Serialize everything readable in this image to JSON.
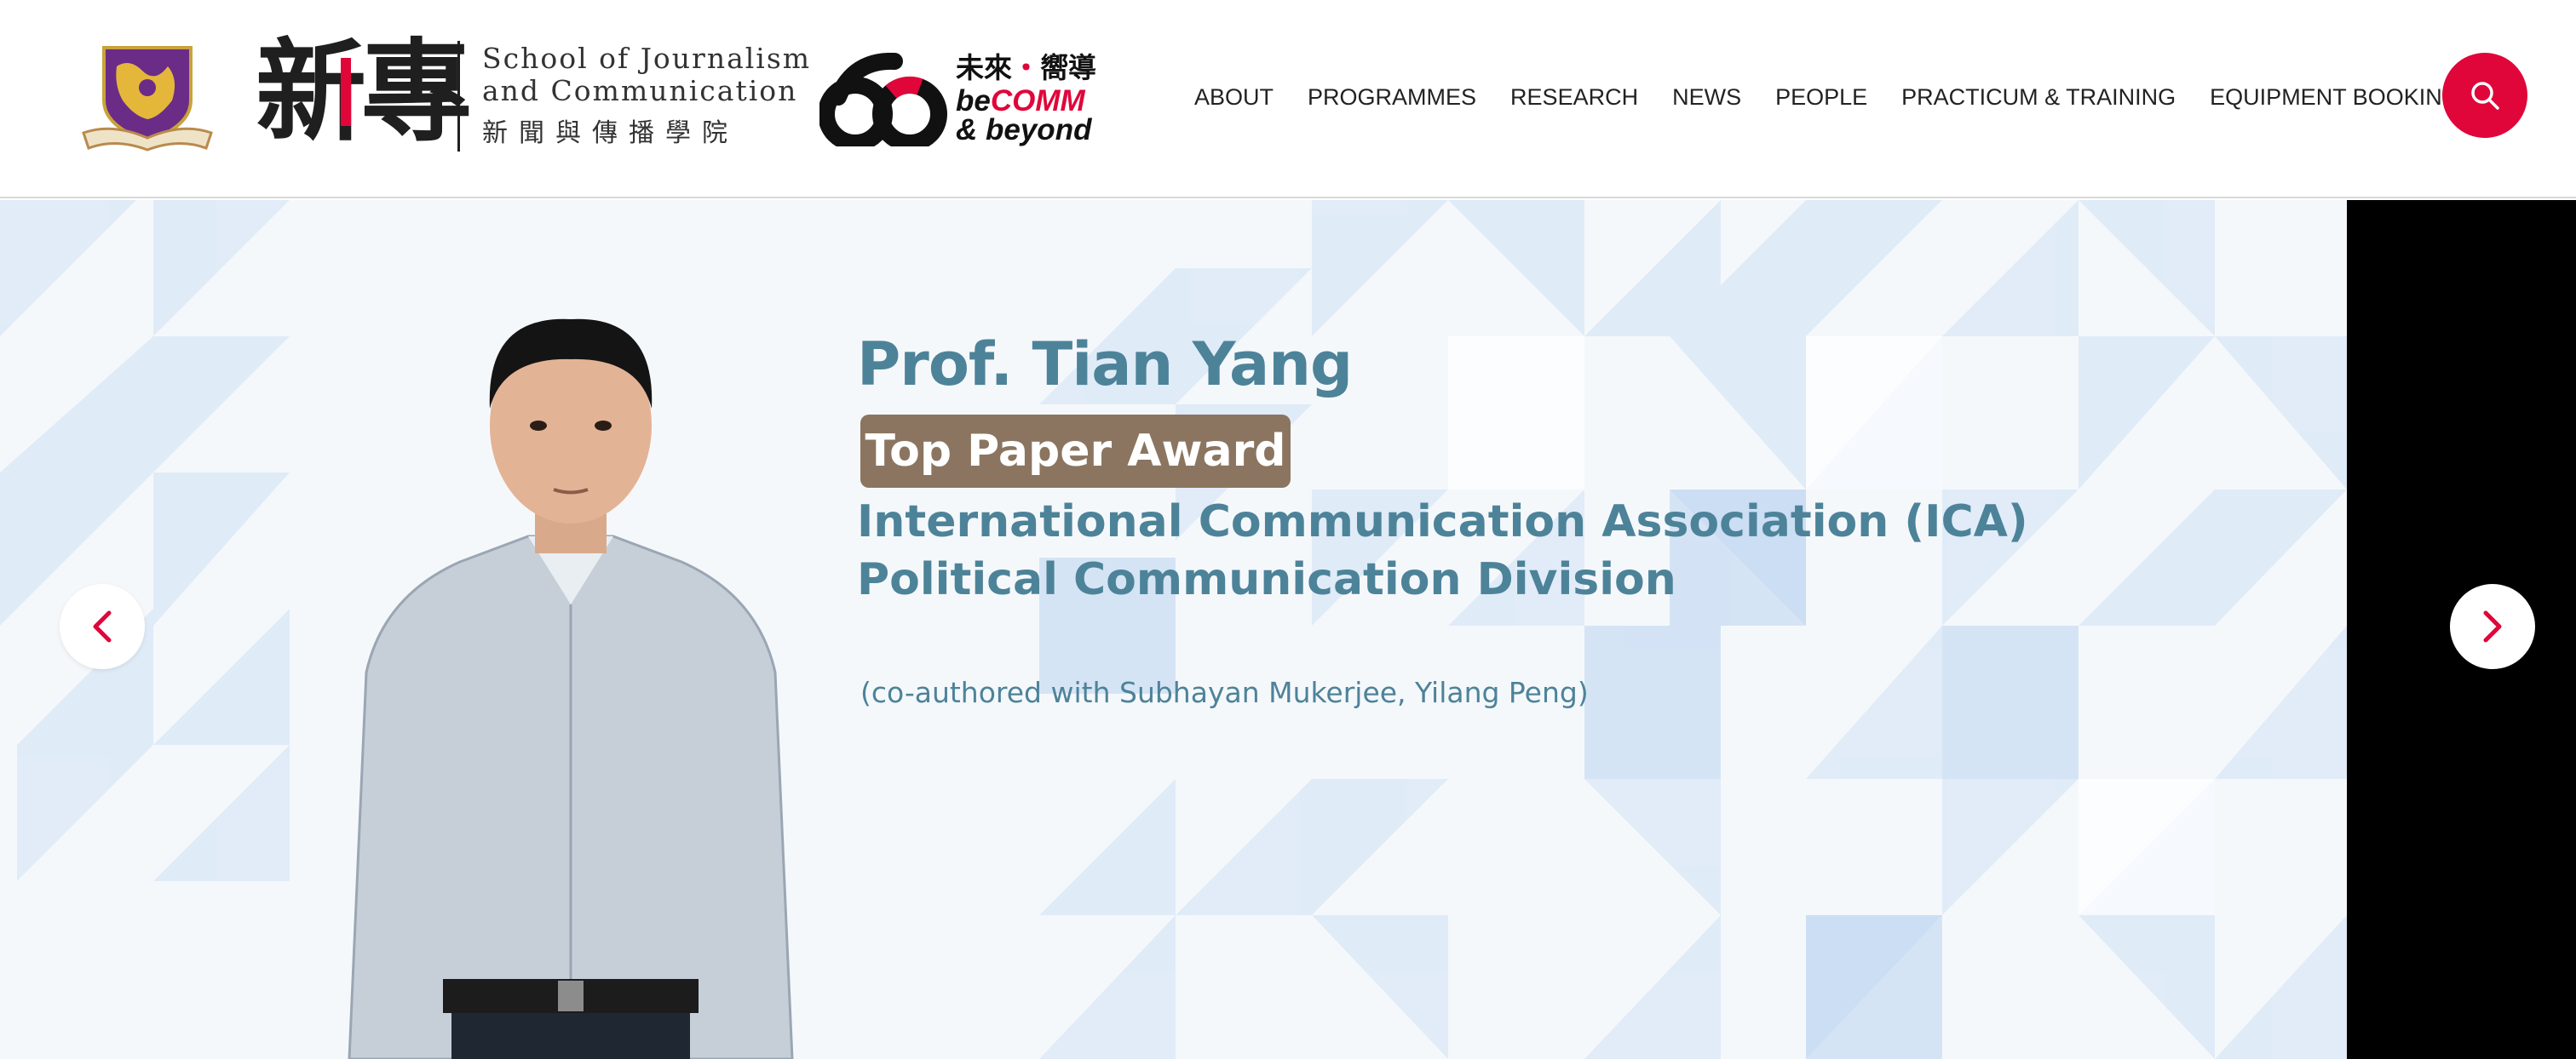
{
  "header": {
    "logo_chars_black_1": "新",
    "logo_chars_red": "",
    "logo_chars_black_2": "專",
    "school_en_line1": "School of Journalism",
    "school_en_line2": "and Communication",
    "school_zh": "新聞與傳播學院",
    "becomm_zh_a": "未來",
    "becomm_zh_dot": "・",
    "becomm_zh_b": "嚮導",
    "becomm_be": "be",
    "becomm_comm": "COMM",
    "becomm_beyond": "& beyond"
  },
  "nav": {
    "items": [
      {
        "label": "ABOUT"
      },
      {
        "label": "PROGRAMMES"
      },
      {
        "label": "RESEARCH"
      },
      {
        "label": "NEWS"
      },
      {
        "label": "PEOPLE"
      },
      {
        "label": "PRACTICUM & TRAINING"
      },
      {
        "label": "EQUIPMENT BOOKING"
      }
    ],
    "search_icon": "search-icon"
  },
  "slide": {
    "name": "Prof. Tian Yang",
    "award": "Top Paper Award",
    "association_line1": "International Communication Association (ICA)",
    "association_line2": "Political Communication Division",
    "coauthors": "(co-authored with Subhayan Mukerjee, Yilang Peng)"
  },
  "carousel": {
    "prev_icon": "chevron-left-icon",
    "next_icon": "chevron-right-icon"
  },
  "colors": {
    "brand_red": "#e0063a",
    "headline_teal": "#4d8399",
    "badge_brown": "#8b7560",
    "pattern_blue": "#cfe1f6"
  }
}
